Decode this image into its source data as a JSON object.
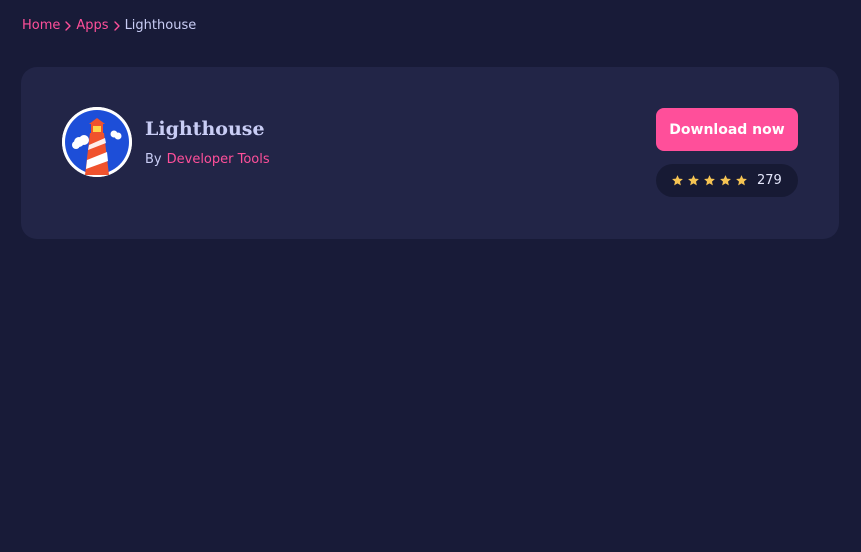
{
  "breadcrumb": {
    "items": [
      {
        "label": "Home"
      },
      {
        "label": "Apps"
      }
    ],
    "current": "Lighthouse"
  },
  "app": {
    "title": "Lighthouse",
    "by_label": "By",
    "author": "Developer Tools",
    "logo_icon": "lighthouse-logo-icon"
  },
  "actions": {
    "download_label": "Download now"
  },
  "rating": {
    "stars": 5,
    "count": "279",
    "star_icon": "star-icon"
  },
  "colors": {
    "background": "#181b38",
    "card": "#222547",
    "accent": "#ff4f9a",
    "star": "#f6c453",
    "text": "#c9cdf5"
  }
}
